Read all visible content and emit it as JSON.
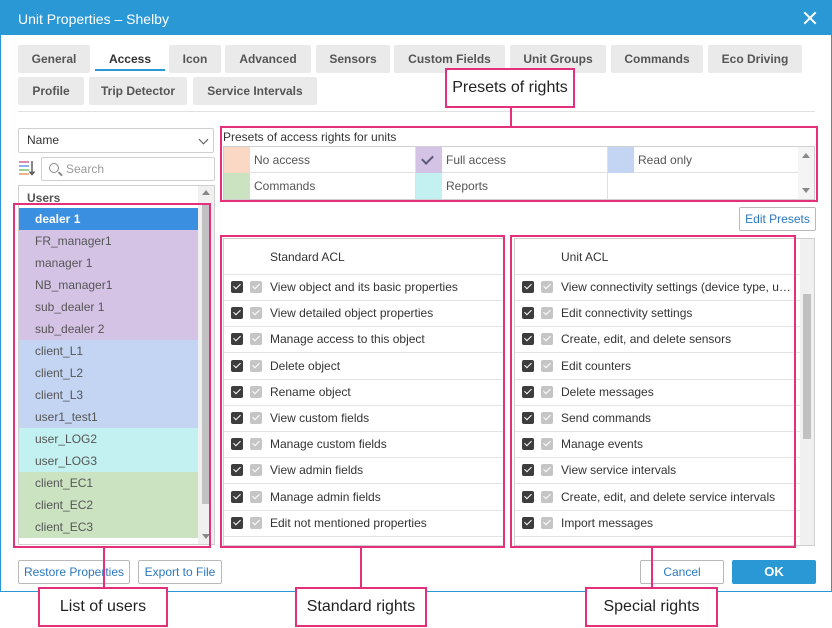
{
  "window": {
    "title": "Unit Properties – Shelby"
  },
  "tabs": [
    {
      "label": "General"
    },
    {
      "label": "Access"
    },
    {
      "label": "Icon"
    },
    {
      "label": "Advanced"
    },
    {
      "label": "Sensors"
    },
    {
      "label": "Custom Fields"
    },
    {
      "label": "Unit Groups"
    },
    {
      "label": "Commands"
    },
    {
      "label": "Eco Driving"
    },
    {
      "label": "Profile"
    },
    {
      "label": "Trip Detector"
    },
    {
      "label": "Service Intervals"
    }
  ],
  "active_tab": "Access",
  "sort_select": {
    "value": "Name"
  },
  "search": {
    "placeholder": "Search"
  },
  "users": {
    "header": "Users",
    "items": [
      {
        "label": "dealer 1",
        "color": "#3a8fe0",
        "selected": true
      },
      {
        "label": "FR_manager1",
        "color": "#d5c3e6"
      },
      {
        "label": "manager 1",
        "color": "#d5c3e6"
      },
      {
        "label": "NB_manager1",
        "color": "#d5c3e6"
      },
      {
        "label": "sub_dealer 1",
        "color": "#d5c3e6"
      },
      {
        "label": "sub_dealer 2",
        "color": "#d5c3e6"
      },
      {
        "label": "client_L1",
        "color": "#c3d5f3"
      },
      {
        "label": "client_L2",
        "color": "#c3d5f3"
      },
      {
        "label": "client_L3",
        "color": "#c3d5f3"
      },
      {
        "label": "user1_test1",
        "color": "#c3d5f3"
      },
      {
        "label": "user_LOG2",
        "color": "#c3f0f0"
      },
      {
        "label": "user_LOG3",
        "color": "#c3f0f0"
      },
      {
        "label": "client_EC1",
        "color": "#cce3c2"
      },
      {
        "label": "client_EC2",
        "color": "#cce3c2"
      },
      {
        "label": "client_EC3",
        "color": "#cce3c2"
      }
    ]
  },
  "presets": {
    "label": "Presets of access rights for units",
    "items": [
      {
        "label": "No access",
        "color": "#fad8c4"
      },
      {
        "label": "Full access",
        "color": "#d5c3e6",
        "checked": true
      },
      {
        "label": "Read only",
        "color": "#c3d5f3"
      },
      {
        "label": "Commands",
        "color": "#cce3c2"
      },
      {
        "label": "Reports",
        "color": "#c3f0f0"
      }
    ]
  },
  "buttons": {
    "edit_presets": "Edit Presets",
    "restore": "Restore Properties",
    "export": "Export to File",
    "cancel": "Cancel",
    "ok": "OK"
  },
  "standard_acl": {
    "header": "Standard ACL",
    "items": [
      "View object and its basic properties",
      "View detailed object properties",
      "Manage access to this object",
      "Delete object",
      "Rename object",
      "View custom fields",
      "Manage custom fields",
      "View admin fields",
      "Manage admin fields",
      "Edit not mentioned properties"
    ]
  },
  "unit_acl": {
    "header": "Unit ACL",
    "items": [
      "View connectivity settings (device type, u…",
      "Edit connectivity settings",
      "Create, edit, and delete sensors",
      "Edit counters",
      "Delete messages",
      "Send commands",
      "Manage events",
      "View service intervals",
      "Create, edit, and delete service intervals",
      "Import messages"
    ]
  },
  "annotations": {
    "presets": "Presets of rights",
    "users": "List of users",
    "standard": "Standard rights",
    "special": "Special rights",
    "color": "#e4307a"
  }
}
